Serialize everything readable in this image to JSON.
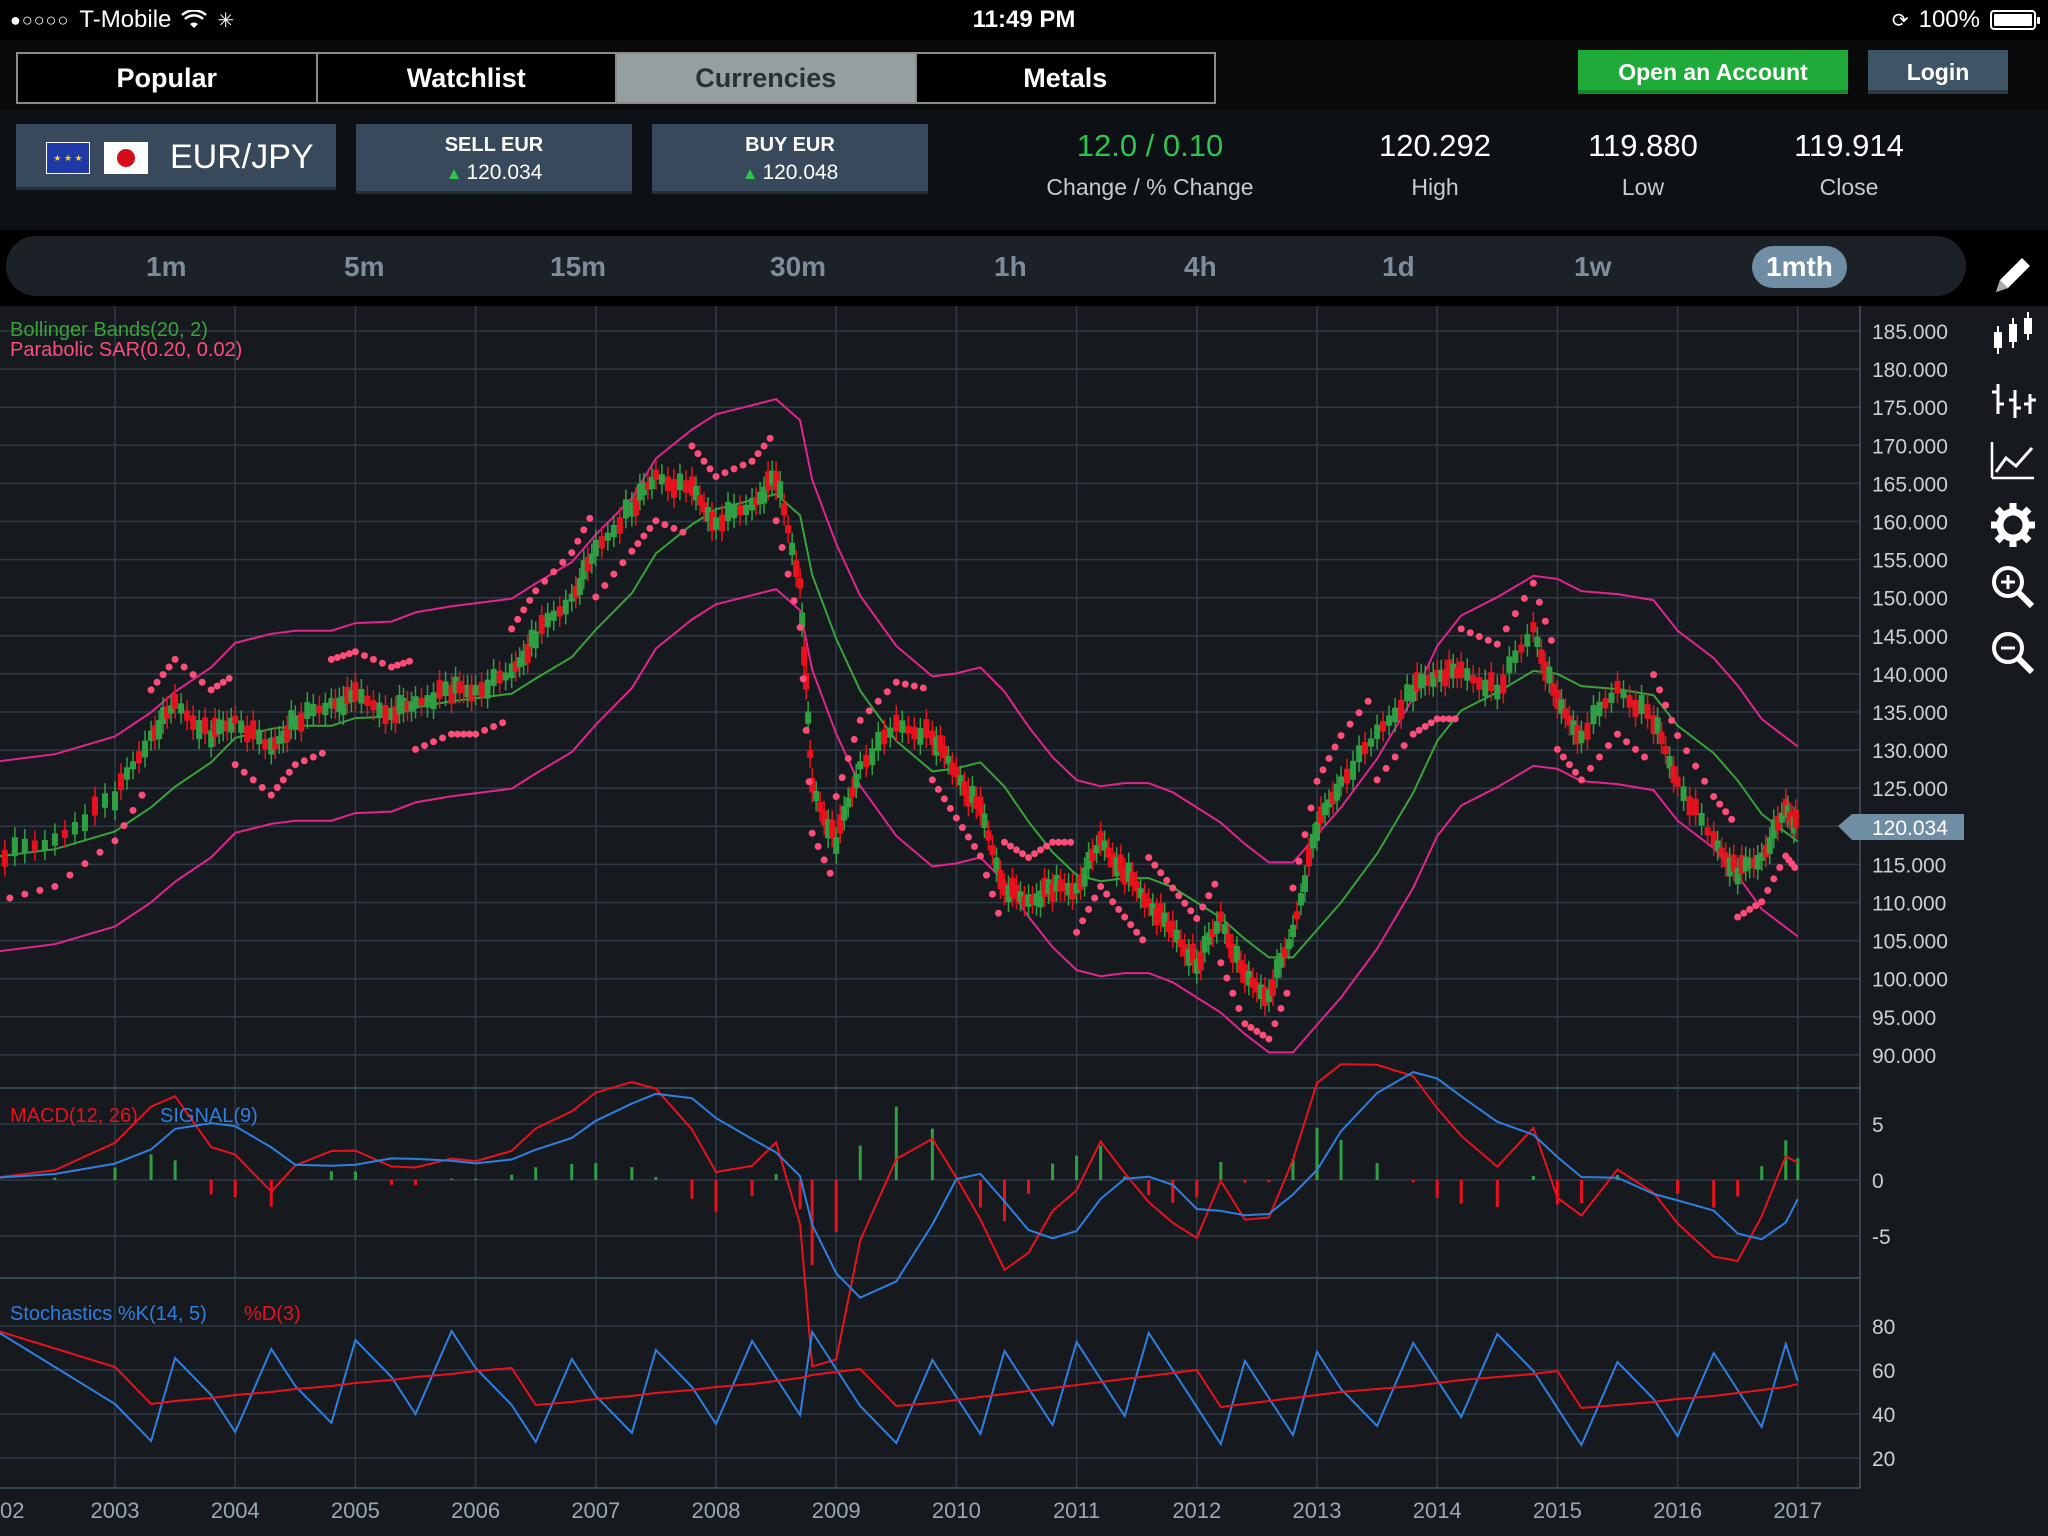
{
  "status": {
    "carrier": "T-Mobile",
    "time": "11:49 PM",
    "battery": "100%"
  },
  "nav": {
    "tabs": [
      "Popular",
      "Watchlist",
      "Currencies",
      "Metals"
    ],
    "active_tab": "Currencies"
  },
  "account": {
    "open_label": "Open an Account",
    "login_label": "Login"
  },
  "instrument": {
    "pair": "EUR/JPY",
    "sell_label": "SELL EUR",
    "sell_price": "120.034",
    "buy_label": "BUY EUR",
    "buy_price": "120.048",
    "change": "12.0 / 0.10",
    "change_label": "Change / % Change",
    "high": "120.292",
    "high_label": "High",
    "low": "119.880",
    "low_label": "Low",
    "close": "119.914",
    "close_label": "Close"
  },
  "timeframes": [
    "1m",
    "5m",
    "15m",
    "30m",
    "1h",
    "4h",
    "1d",
    "1w",
    "1mth"
  ],
  "active_timeframe": "1mth",
  "tools": [
    "pencil-icon",
    "candlestick-icon",
    "ohlc-icon",
    "line-chart-icon",
    "gear-icon",
    "zoom-in-icon",
    "zoom-out-icon"
  ],
  "colors": {
    "up": "#2ea043",
    "down": "#e8121e",
    "bollinger_mid": "#3aa23a",
    "bollinger_band": "#e0258e",
    "sar": "#ff4d7a",
    "macd": "#e8121e",
    "signal": "#2f7fe0"
  },
  "chart_data": {
    "type": "candlestick",
    "current_price": "120.034",
    "indicator_labels": {
      "bollinger": "Bollinger Bands(20, 2)",
      "sar": "Parabolic SAR(0.20, 0.02)",
      "macd": "MACD(12, 26)",
      "signal": "SIGNAL(9)",
      "stoch": "Stochastics %K(14, 5)",
      "stoch_d": "%D(3)"
    },
    "x_ticks": [
      "02",
      "2003",
      "2004",
      "2005",
      "2006",
      "2007",
      "2008",
      "2009",
      "2010",
      "2011",
      "2012",
      "2013",
      "2014",
      "2015",
      "2016",
      "2017"
    ],
    "price_ticks": [
      "185.000",
      "180.000",
      "175.000",
      "170.000",
      "165.000",
      "160.000",
      "155.000",
      "150.000",
      "145.000",
      "140.000",
      "135.000",
      "130.000",
      "125.000",
      "120.000",
      "115.000",
      "110.000",
      "105.000",
      "100.000",
      "95.000",
      "90.000"
    ],
    "macd_ticks": [
      "5",
      "0",
      "-5"
    ],
    "stoch_ticks": [
      "80",
      "60",
      "40",
      "20"
    ],
    "price_series": [
      [
        2002.0,
        116
      ],
      [
        2002.5,
        118
      ],
      [
        2003.0,
        124
      ],
      [
        2003.3,
        132
      ],
      [
        2003.5,
        136
      ],
      [
        2003.8,
        132
      ],
      [
        2004.0,
        134
      ],
      [
        2004.3,
        130
      ],
      [
        2004.5,
        134
      ],
      [
        2004.8,
        136
      ],
      [
        2005.0,
        137
      ],
      [
        2005.3,
        135
      ],
      [
        2005.5,
        136
      ],
      [
        2005.8,
        138
      ],
      [
        2006.0,
        138
      ],
      [
        2006.3,
        140
      ],
      [
        2006.5,
        145
      ],
      [
        2006.8,
        150
      ],
      [
        2007.0,
        156
      ],
      [
        2007.3,
        162
      ],
      [
        2007.5,
        166
      ],
      [
        2007.8,
        164
      ],
      [
        2008.0,
        160
      ],
      [
        2008.3,
        162
      ],
      [
        2008.5,
        166
      ],
      [
        2008.7,
        152
      ],
      [
        2008.8,
        125
      ],
      [
        2009.0,
        118
      ],
      [
        2009.2,
        128
      ],
      [
        2009.5,
        133
      ],
      [
        2009.8,
        132
      ],
      [
        2010.0,
        127
      ],
      [
        2010.2,
        122
      ],
      [
        2010.4,
        112
      ],
      [
        2010.6,
        110
      ],
      [
        2010.8,
        112
      ],
      [
        2011.0,
        112
      ],
      [
        2011.2,
        118
      ],
      [
        2011.4,
        114
      ],
      [
        2011.6,
        110
      ],
      [
        2011.8,
        106
      ],
      [
        2012.0,
        102
      ],
      [
        2012.2,
        108
      ],
      [
        2012.4,
        100
      ],
      [
        2012.6,
        98
      ],
      [
        2012.8,
        106
      ],
      [
        2013.0,
        120
      ],
      [
        2013.2,
        126
      ],
      [
        2013.5,
        132
      ],
      [
        2013.8,
        138
      ],
      [
        2014.0,
        140
      ],
      [
        2014.2,
        140
      ],
      [
        2014.5,
        138
      ],
      [
        2014.8,
        146
      ],
      [
        2015.0,
        136
      ],
      [
        2015.2,
        132
      ],
      [
        2015.5,
        138
      ],
      [
        2015.8,
        134
      ],
      [
        2016.0,
        126
      ],
      [
        2016.3,
        118
      ],
      [
        2016.5,
        114
      ],
      [
        2016.7,
        116
      ],
      [
        2016.9,
        122
      ],
      [
        2017.0,
        120
      ]
    ]
  }
}
